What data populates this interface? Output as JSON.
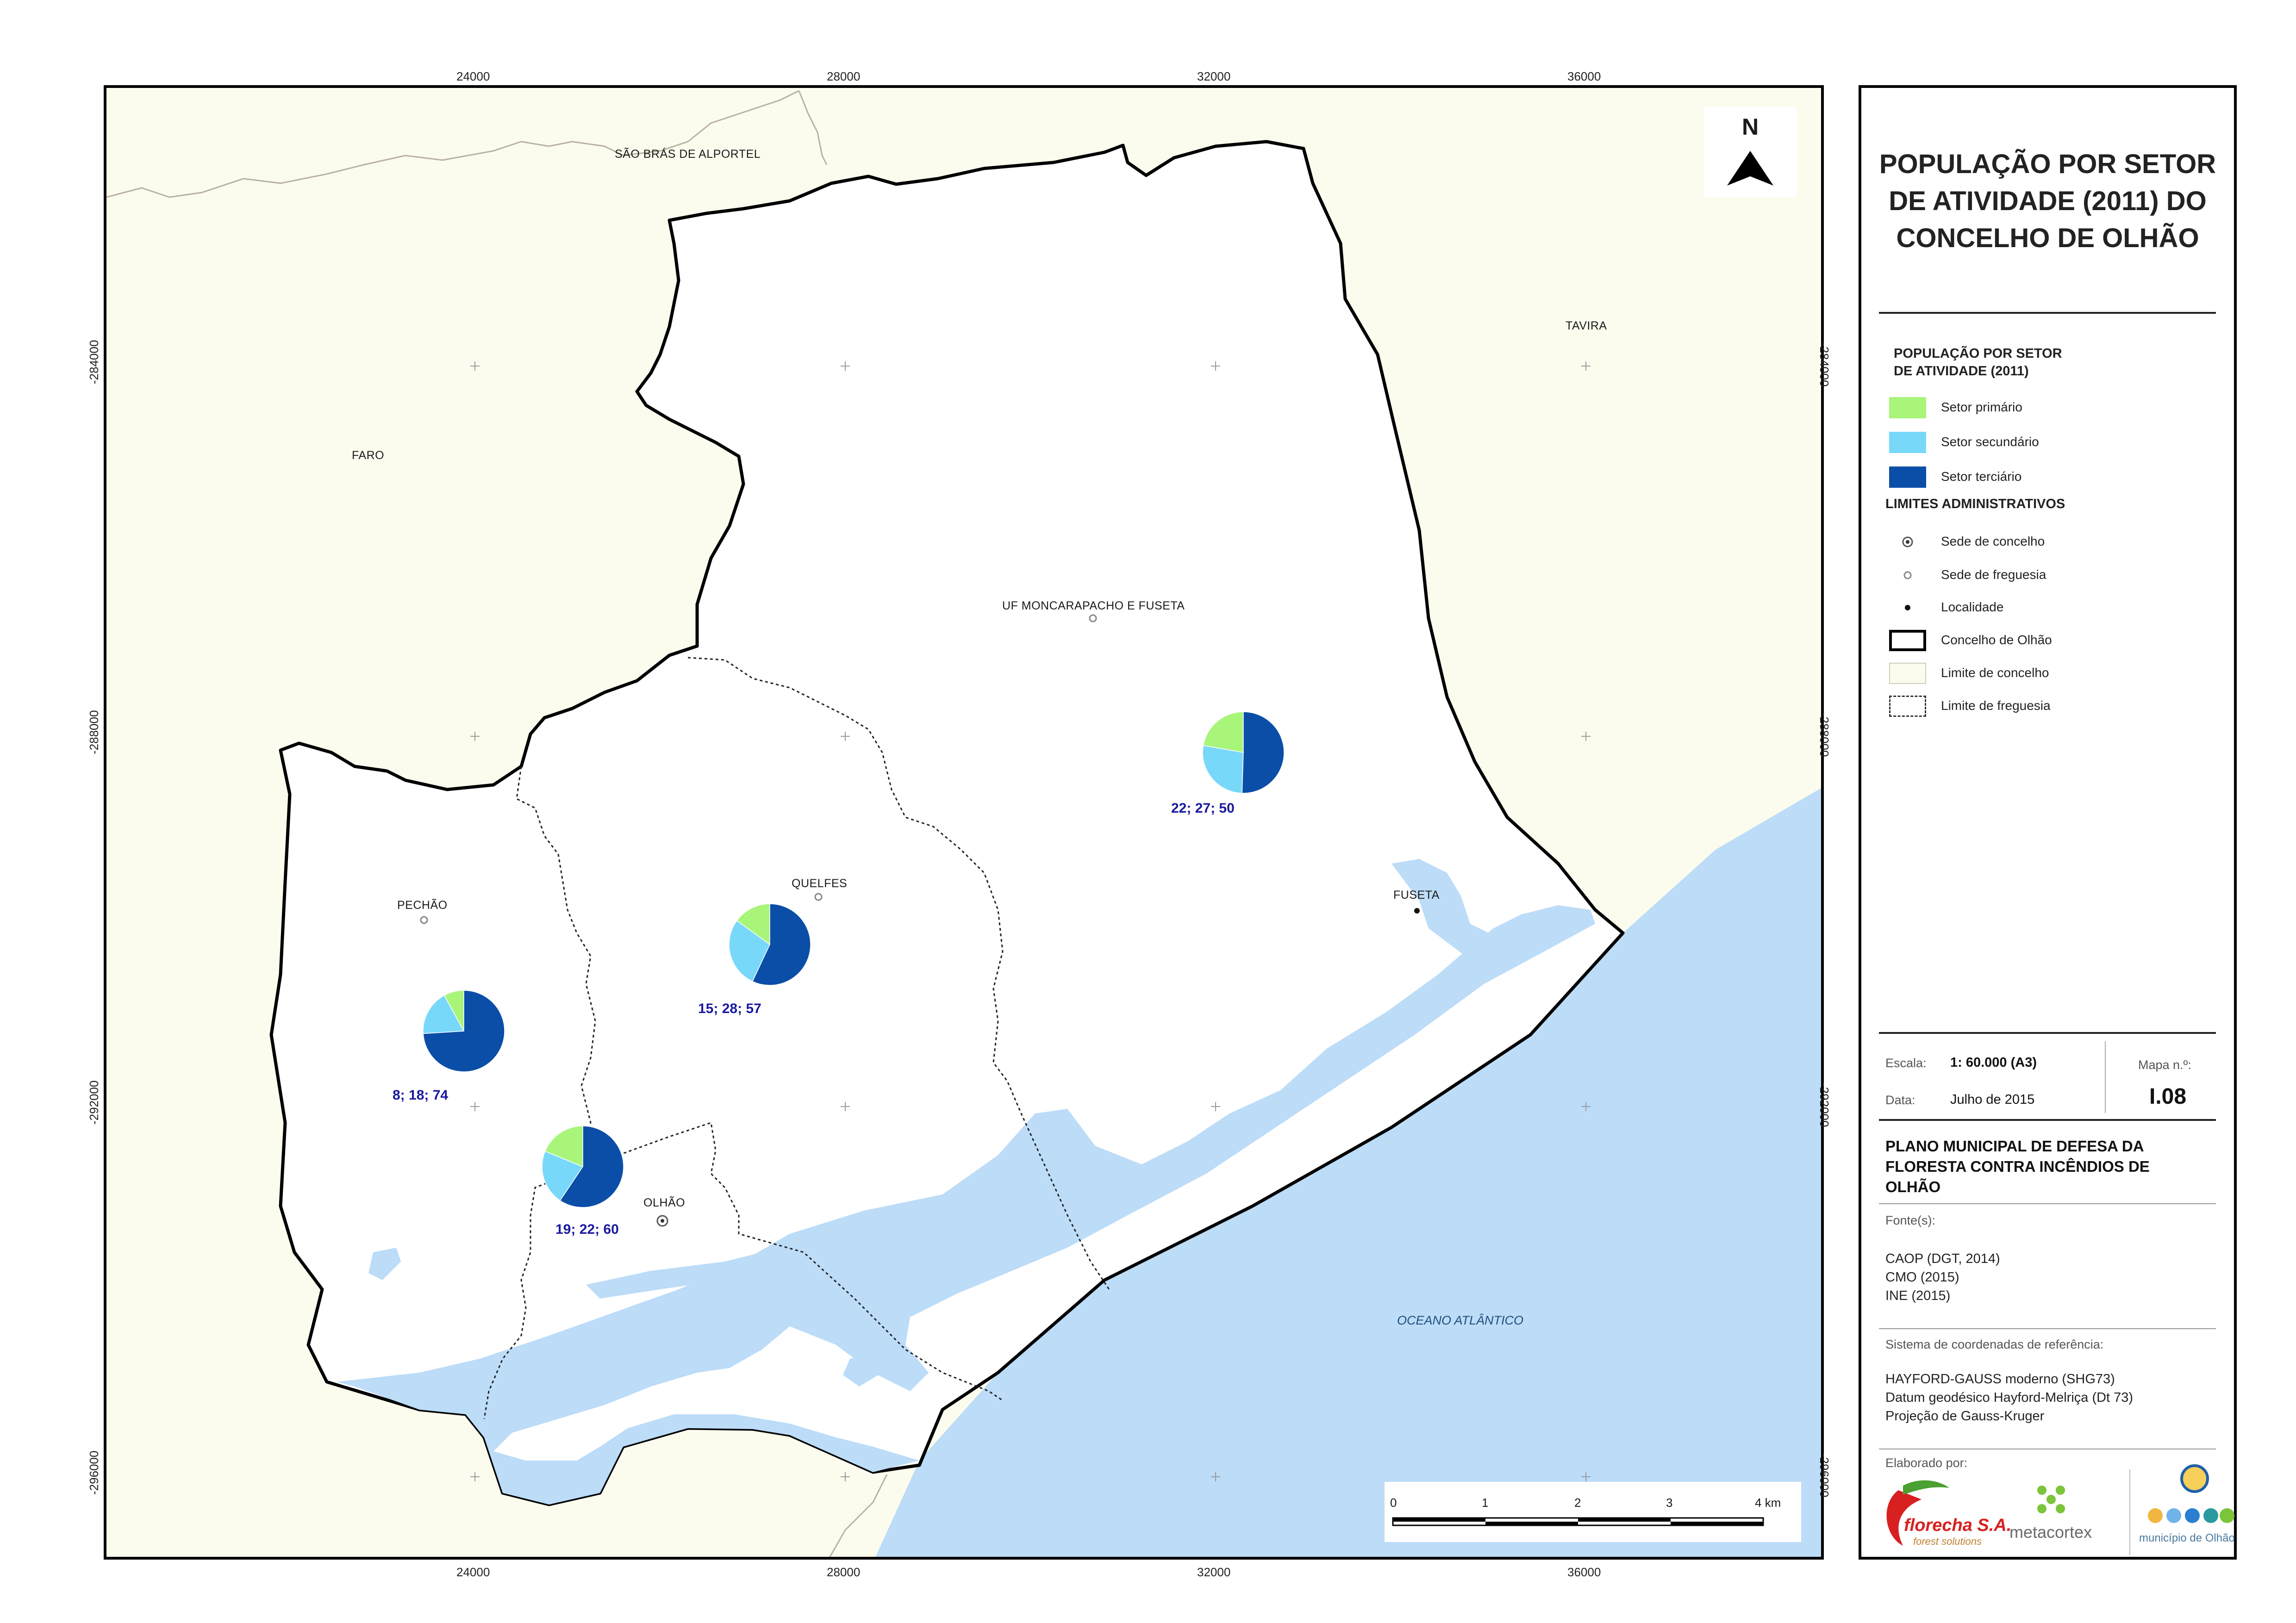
{
  "map": {
    "grid_x_top": [
      "24000",
      "28000",
      "32000",
      "36000"
    ],
    "grid_x_bottom": [
      "24000",
      "28000",
      "32000",
      "36000"
    ],
    "grid_y_left": [
      "-284000",
      "-288000",
      "-292000",
      "-296000"
    ],
    "grid_y_right": [
      "-284000",
      "-288000",
      "-292000",
      "-296000"
    ],
    "places": {
      "sao_bras": "SÃO BRÁS DE ALPORTEL",
      "tavira": "TAVIRA",
      "faro": "FARO",
      "moncarapacho": "UF MONCARAPACHO E FUSETA",
      "quelfes": "QUELFES",
      "pechao": "PECHÃO",
      "fuseta": "FUSETA",
      "olhao": "OLHÃO"
    },
    "ocean": "OCEANO ATLÂNTICO",
    "north": "N",
    "scale_ticks": [
      "0",
      "1",
      "2",
      "3",
      "4 km"
    ],
    "colors": {
      "land_outside": "#fcfcee",
      "inside": "#ffffff",
      "water": "#bcdcf8",
      "primary": "#a8f57a",
      "secondary": "#78d8fa",
      "tertiary": "#0a4ea8"
    },
    "pies": [
      {
        "id": "moncarapacho",
        "label": "22; 27; 50",
        "values": [
          22,
          27,
          50
        ]
      },
      {
        "id": "quelfes",
        "label": "15; 28; 57",
        "values": [
          15,
          28,
          57
        ]
      },
      {
        "id": "pechao",
        "label": "8; 18; 74",
        "values": [
          8,
          18,
          74
        ]
      },
      {
        "id": "olhao",
        "label": "19; 22; 60",
        "values": [
          19,
          22,
          60
        ]
      }
    ]
  },
  "panel": {
    "title": [
      "POPULAÇÃO POR SETOR",
      "DE ATIVIDADE (2011) DO",
      "CONCELHO DE OLHÃO"
    ],
    "legend_pop_title": [
      "POPULAÇÃO POR SETOR",
      "DE ATIVIDADE (2011)"
    ],
    "legend_pop": [
      "Setor primário",
      "Setor secundário",
      "Setor terciário"
    ],
    "legend_admin_title": "LIMITES ADMINISTRATIVOS",
    "legend_admin": [
      "Sede de concelho",
      "Sede de freguesia",
      "Localidade",
      "Concelho de Olhão",
      "Limite de concelho",
      "Limite de freguesia"
    ],
    "scale_label": "Escala:",
    "scale_value": "1: 60.000 (A3)",
    "date_label": "Data:",
    "date_value": "Julho de 2015",
    "map_no_label": "Mapa n.º:",
    "map_no_value": "I.08",
    "plan": [
      "PLANO MUNICIPAL DE DEFESA DA",
      "FLORESTA CONTRA INCÊNDIOS DE",
      "OLHÃO"
    ],
    "sources_label": "Fonte(s):",
    "sources": [
      "CAOP (DGT, 2014)",
      "CMO (2015)",
      "INE (2015)"
    ],
    "crs_label": "Sistema de coordenadas de referência:",
    "crs": [
      "HAYFORD-GAUSS moderno (SHG73)",
      "Datum geodésico Hayford-Melriça (Dt 73)",
      "Projeção de Gauss-Kruger"
    ],
    "made_by_label": "Elaborado por:",
    "logos": {
      "florecha": "florecha S.A.",
      "florecha_sub": "forest solutions",
      "metacortex": "metacortex",
      "municipio": "município de Olhão"
    }
  }
}
